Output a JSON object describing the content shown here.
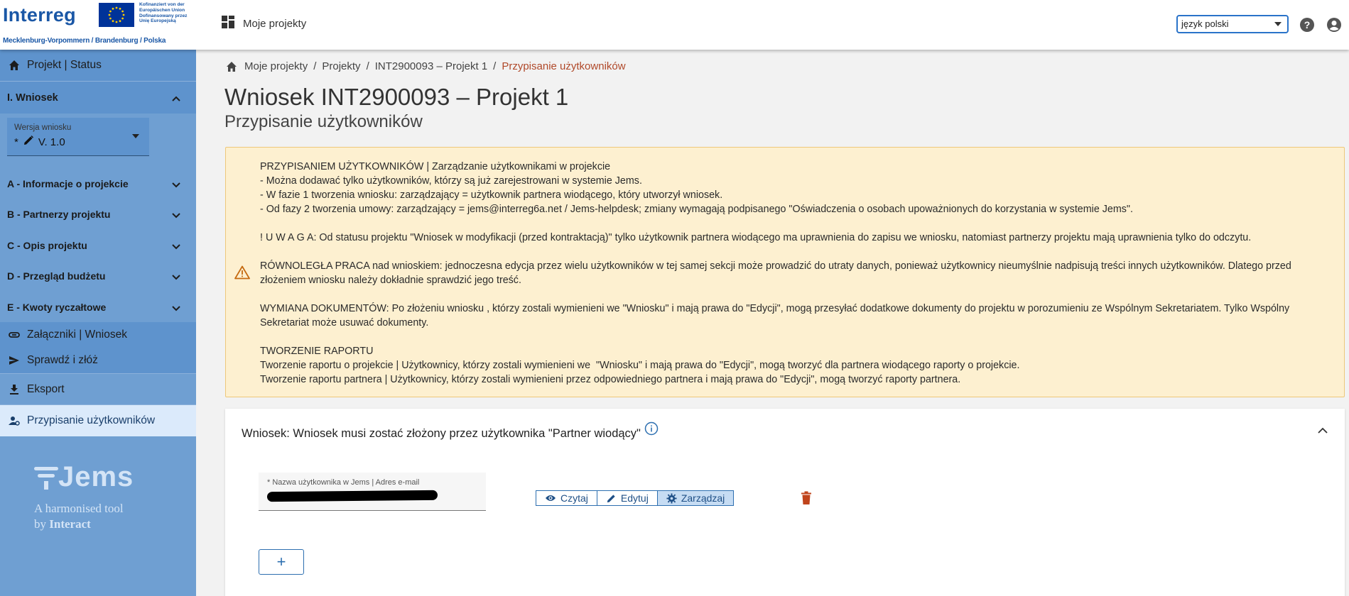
{
  "header": {
    "logo": {
      "brand": "Interreg",
      "eu_text": "Kofinanziert von der\nEuropäischen Union\nDofinansowany przez\nUnię Europejską",
      "region": "Mecklenburg-Vorpommern / Brandenburg / Polska"
    },
    "nav_label": "Moje projekty",
    "language": "język polski",
    "icons": {
      "nav": "apps-grid-icon",
      "help": "help-icon",
      "account": "account-icon"
    }
  },
  "sidebar": {
    "status_label": "Projekt | Status",
    "section_label": "I. Wniosek",
    "version": {
      "label": "Wersja wniosku",
      "required_mark": "*",
      "value": "V. 1.0"
    },
    "groups": [
      "A - Informacje o projekcie",
      "B - Partnerzy projektu",
      "C - Opis projektu",
      "D - Przegląd budżetu",
      "E - Kwoty ryczałtowe"
    ],
    "attachments_label": "Załączniki | Wniosek",
    "check_submit_label": "Sprawdź i złóż",
    "export_label": "Eksport",
    "assign_users_label": "Przypisanie użytkowników",
    "jems": {
      "word": "Jems",
      "tagline_1": "A harmonised tool",
      "tagline_2_prefix": "by ",
      "tagline_2_brand": "Interact"
    }
  },
  "breadcrumb": {
    "items": [
      "Moje projekty",
      "Projekty",
      "INT2900093 – Projekt 1"
    ],
    "current": "Przypisanie użytkowników",
    "separator": "/"
  },
  "page": {
    "title": "Wniosek INT2900093 – Projekt 1",
    "subtitle": "Przypisanie użytkowników"
  },
  "alert": {
    "lines": [
      "PRZYPISANIEM UŻYTKOWNIKÓW | Zarządzanie użytkownikami w projekcie",
      "- Można dodawać tylko użytkowników, którzy są już zarejestrowani w systemie Jems.",
      "- W fazie 1 tworzenia wniosku: zarządzający = użytkownik partnera wiodącego, który utworzył wniosek.",
      "- Od fazy 2 tworzenia umowy: zarządzający = jems@interreg6a.net / Jems-helpdesk; zmiany wymagają podpisanego \"Oświadczenia o osobach upoważnionych do korzystania w systemie Jems\".",
      "",
      "! U W A G A: Od statusu projektu \"Wniosek w modyfikacji (przed kontraktacją)\" tylko użytkownik partnera wiodącego ma uprawnienia do zapisu we wniosku, natomiast partnerzy projektu mają uprawnienia tylko do odczytu.",
      "",
      "RÓWNOLEGŁA PRACA nad wnioskiem: jednoczesna edycja przez wielu użytkowników w tej samej sekcji może prowadzić do utraty danych, ponieważ użytkownicy nieumyślnie nadpisują treści innych użytkowników. Dlatego przed złożeniem wniosku należy dokładnie sprawdzić jego treść.",
      "",
      "WYMIANA DOKUMENTÓW: Po złożeniu wniosku , którzy zostali wymienieni we \"Wniosku\" i mają prawa do \"Edycji\", mogą przesyłać dodatkowe dokumenty do projektu w porozumieniu ze Wspólnym Sekretariatem. Tylko Wspólny Sekretariat może usuwać dokumenty.",
      "",
      "TWORZENIE RAPORTU",
      "Tworzenie raportu o projekcie | Użytkownicy, którzy zostali wymienieni we  \"Wniosku\" i mają prawa do \"Edycji\", mogą tworzyć dla partnera wiodącego raporty o projekcie.",
      "Tworzenie raportu partnera | Użytkownicy, którzy zostali wymienieni przez odpowiedniego partnera i mają prawa do \"Edycji\", mogą tworzyć raporty partnera."
    ]
  },
  "card": {
    "title": "Wniosek: Wniosek musi zostać złożony przez użytkownika \"Partner wiodący\"",
    "user_field": {
      "required_mark": "*",
      "label": "Nazwa użytkownika w Jems | Adres e-mail"
    },
    "permissions": [
      {
        "label": "Czytaj",
        "icon": "eye-icon",
        "selected": false
      },
      {
        "label": "Edytuj",
        "icon": "pencil-icon",
        "selected": false
      },
      {
        "label": "Zarządzaj",
        "icon": "gear-icon",
        "selected": true
      }
    ],
    "add_label": "+"
  },
  "colors": {
    "sidebar_bg": "#6f9fd2",
    "sidebar_active_bg": "#dbeafb",
    "alert_bg": "#fdf0d0",
    "breadcrumb_current": "#b0492a",
    "delete": "#c0441c",
    "accent": "#2d6fb0"
  }
}
